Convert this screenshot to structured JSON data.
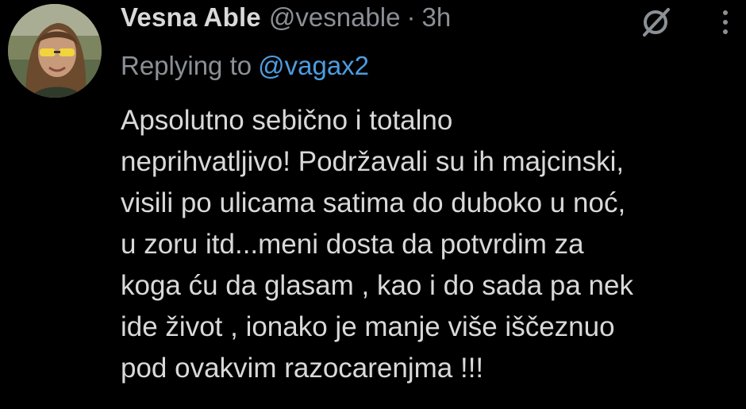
{
  "tweet": {
    "display_name": "Vesna Able",
    "handle": "@vesnable",
    "separator": "·",
    "time": "3h",
    "reply_prefix": "Replying to",
    "reply_handle": "@vagax2",
    "body_lines": [
      "Apsolutno sebično i totalno",
      "neprihvatljivo! Podržavali su ih majcinski,",
      "visili po ulicama satima do duboko u noć,",
      "u zoru itd...meni dosta da potvrdim za",
      "koga ću da glasam , kao i do sada pa nek",
      "ide život , ionako je manje više iščeznuo",
      "pod ovakvim razocarenjma !!!"
    ]
  },
  "icons": {
    "avatar": "avatar-photo",
    "grok": "grok-slash-circle-icon",
    "more": "more-vertical-icon"
  },
  "colors": {
    "background": "#000000",
    "text": "#d9d9d9",
    "muted": "#8b9096",
    "link": "#4d9de0"
  }
}
